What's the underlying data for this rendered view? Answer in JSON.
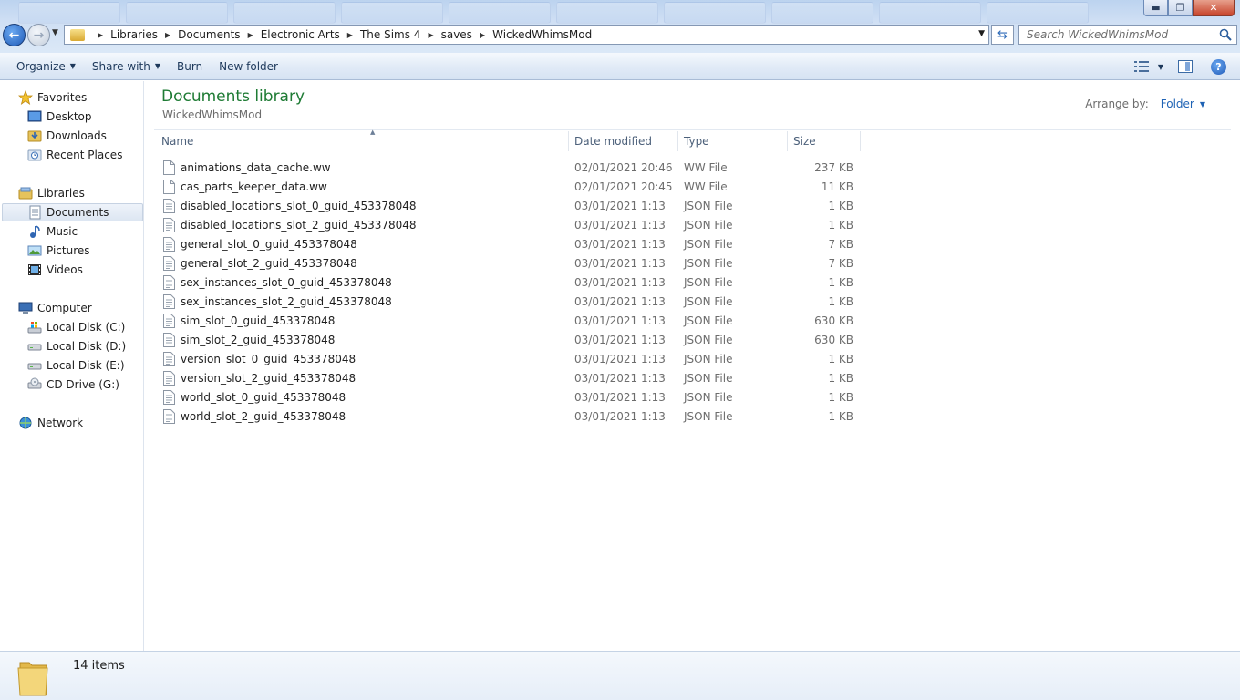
{
  "window": {
    "minimize_icon": "minimize-icon",
    "restore_icon": "restore-icon",
    "close_icon": "close-icon",
    "minimize_glyph": "▬",
    "restore_glyph": "❐",
    "close_glyph": "✕"
  },
  "navigation": {
    "back_glyph": "←",
    "forward_glyph": "→",
    "history_dropdown_glyph": "▼"
  },
  "address": {
    "breadcrumbs": [
      "Libraries",
      "Documents",
      "Electronic Arts",
      "The Sims 4",
      "saves",
      "WickedWhimsMod"
    ],
    "dropdown_glyph": "▼",
    "refresh_glyph": "⇆"
  },
  "search": {
    "placeholder": "Search WickedWhimsMod"
  },
  "toolbar": {
    "organize": "Organize",
    "share_with": "Share with",
    "burn": "Burn",
    "new_folder": "New folder",
    "caret": "▼",
    "help_glyph": "?"
  },
  "sidebar": {
    "favorites": {
      "label": "Favorites",
      "items": [
        "Desktop",
        "Downloads",
        "Recent Places"
      ]
    },
    "libraries": {
      "label": "Libraries",
      "items": [
        "Documents",
        "Music",
        "Pictures",
        "Videos"
      ],
      "selected": "Documents"
    },
    "computer": {
      "label": "Computer",
      "items": [
        "Local Disk (C:)",
        "Local Disk (D:)",
        "Local Disk (E:)",
        "CD Drive (G:)"
      ]
    },
    "network": {
      "label": "Network"
    }
  },
  "library": {
    "title": "Documents library",
    "subtitle": "WickedWhimsMod",
    "arrange_label": "Arrange by:",
    "arrange_value": "Folder",
    "arrange_caret": "▼"
  },
  "columns": {
    "name": "Name",
    "date": "Date modified",
    "type": "Type",
    "size": "Size",
    "sort_glyph": "▲"
  },
  "files": [
    {
      "name": "animations_data_cache.ww",
      "date": "02/01/2021 20:46",
      "type": "WW File",
      "size": "237 KB",
      "icon": "blank-file-icon"
    },
    {
      "name": "cas_parts_keeper_data.ww",
      "date": "02/01/2021 20:45",
      "type": "WW File",
      "size": "11 KB",
      "icon": "blank-file-icon"
    },
    {
      "name": "disabled_locations_slot_0_guid_453378048",
      "date": "03/01/2021 1:13",
      "type": "JSON File",
      "size": "1 KB",
      "icon": "text-file-icon"
    },
    {
      "name": "disabled_locations_slot_2_guid_453378048",
      "date": "03/01/2021 1:13",
      "type": "JSON File",
      "size": "1 KB",
      "icon": "text-file-icon"
    },
    {
      "name": "general_slot_0_guid_453378048",
      "date": "03/01/2021 1:13",
      "type": "JSON File",
      "size": "7 KB",
      "icon": "text-file-icon"
    },
    {
      "name": "general_slot_2_guid_453378048",
      "date": "03/01/2021 1:13",
      "type": "JSON File",
      "size": "7 KB",
      "icon": "text-file-icon"
    },
    {
      "name": "sex_instances_slot_0_guid_453378048",
      "date": "03/01/2021 1:13",
      "type": "JSON File",
      "size": "1 KB",
      "icon": "text-file-icon"
    },
    {
      "name": "sex_instances_slot_2_guid_453378048",
      "date": "03/01/2021 1:13",
      "type": "JSON File",
      "size": "1 KB",
      "icon": "text-file-icon"
    },
    {
      "name": "sim_slot_0_guid_453378048",
      "date": "03/01/2021 1:13",
      "type": "JSON File",
      "size": "630 KB",
      "icon": "text-file-icon"
    },
    {
      "name": "sim_slot_2_guid_453378048",
      "date": "03/01/2021 1:13",
      "type": "JSON File",
      "size": "630 KB",
      "icon": "text-file-icon"
    },
    {
      "name": "version_slot_0_guid_453378048",
      "date": "03/01/2021 1:13",
      "type": "JSON File",
      "size": "1 KB",
      "icon": "text-file-icon"
    },
    {
      "name": "version_slot_2_guid_453378048",
      "date": "03/01/2021 1:13",
      "type": "JSON File",
      "size": "1 KB",
      "icon": "text-file-icon"
    },
    {
      "name": "world_slot_0_guid_453378048",
      "date": "03/01/2021 1:13",
      "type": "JSON File",
      "size": "1 KB",
      "icon": "text-file-icon"
    },
    {
      "name": "world_slot_2_guid_453378048",
      "date": "03/01/2021 1:13",
      "type": "JSON File",
      "size": "1 KB",
      "icon": "text-file-icon"
    }
  ],
  "status": {
    "item_count": "14 items"
  },
  "colors": {
    "library_title": "#1e7b34",
    "link_blue": "#1f63b5",
    "muted_text": "#6d6d6d"
  }
}
